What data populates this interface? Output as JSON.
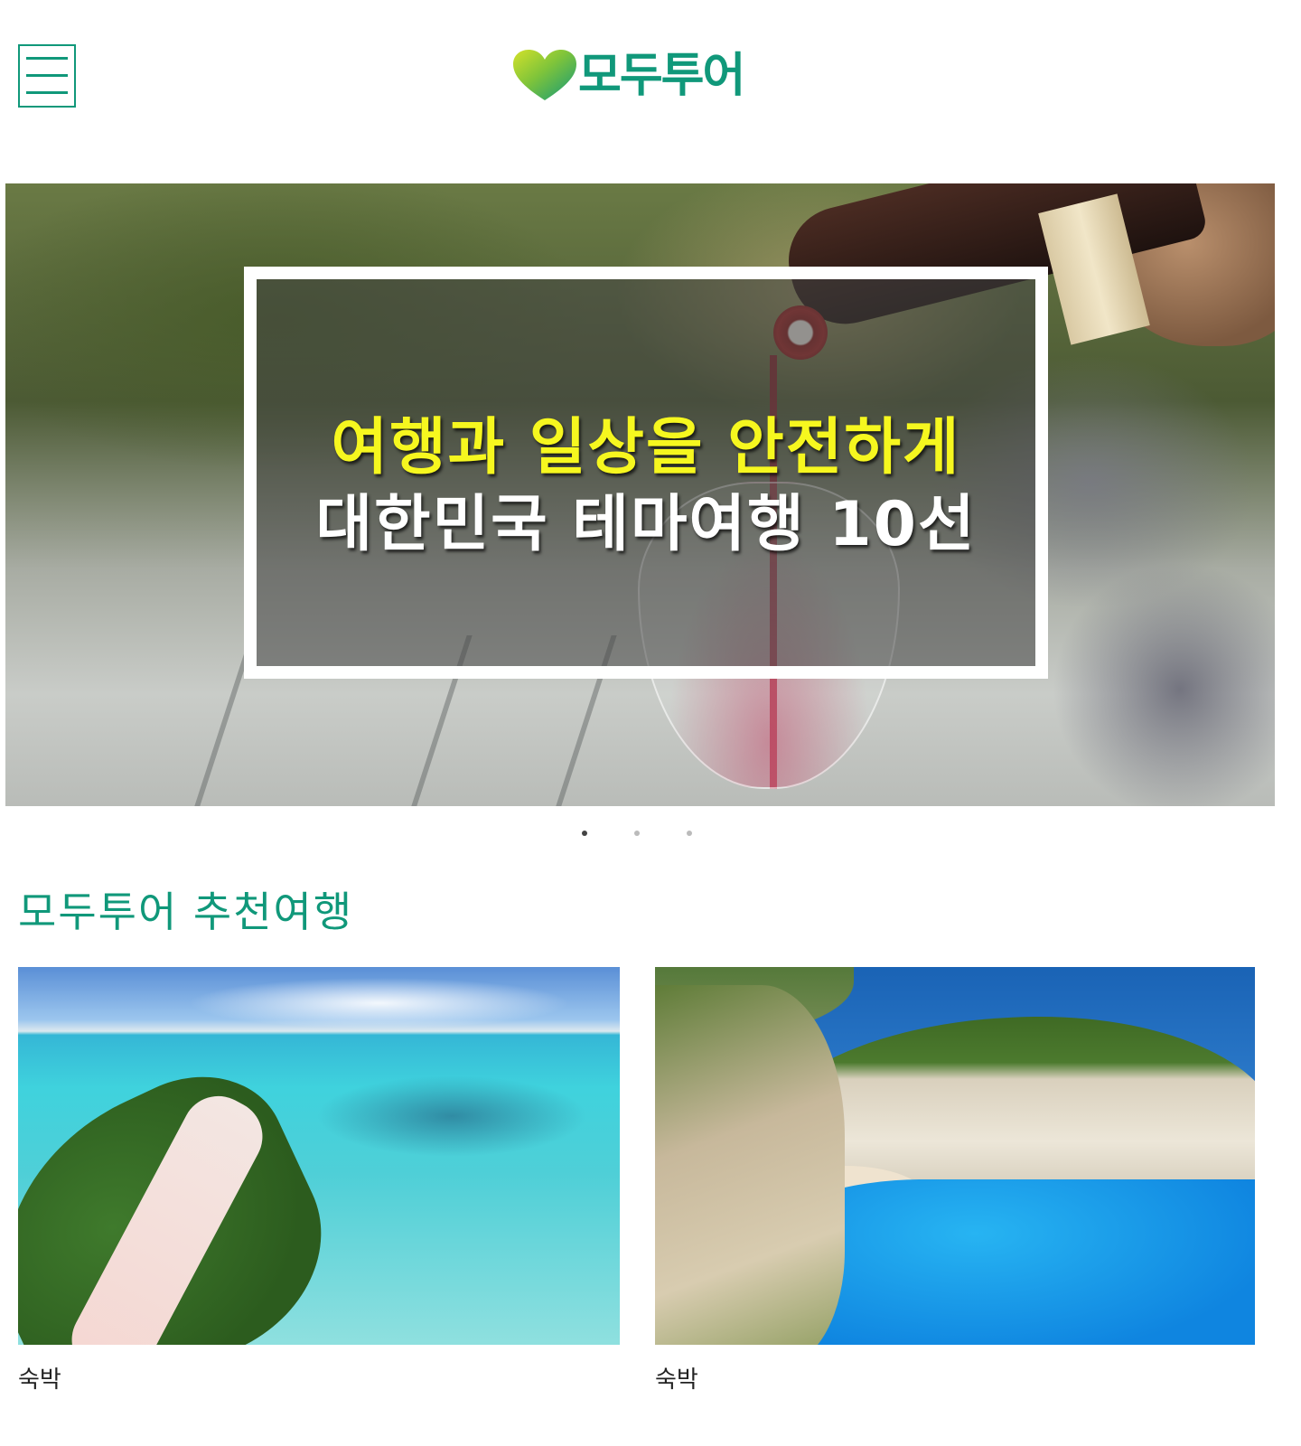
{
  "header": {
    "menu_icon": "hamburger-menu-icon",
    "logo_text": "모두투어",
    "brand_color": "#10987a",
    "logo_heart_colors": [
      "#c9dc24",
      "#10987a"
    ]
  },
  "hero": {
    "line1": "여행과 일상을 안전하게",
    "line2": "대한민국 테마여행 10선",
    "line1_color": "#f6f71f",
    "line2_color": "#ffffff",
    "slide_count": 3,
    "active_slide": 1
  },
  "recommend": {
    "title": "모두투어 추천여행",
    "cards": [
      {
        "caption": "숙박"
      },
      {
        "caption": "숙박"
      }
    ]
  }
}
